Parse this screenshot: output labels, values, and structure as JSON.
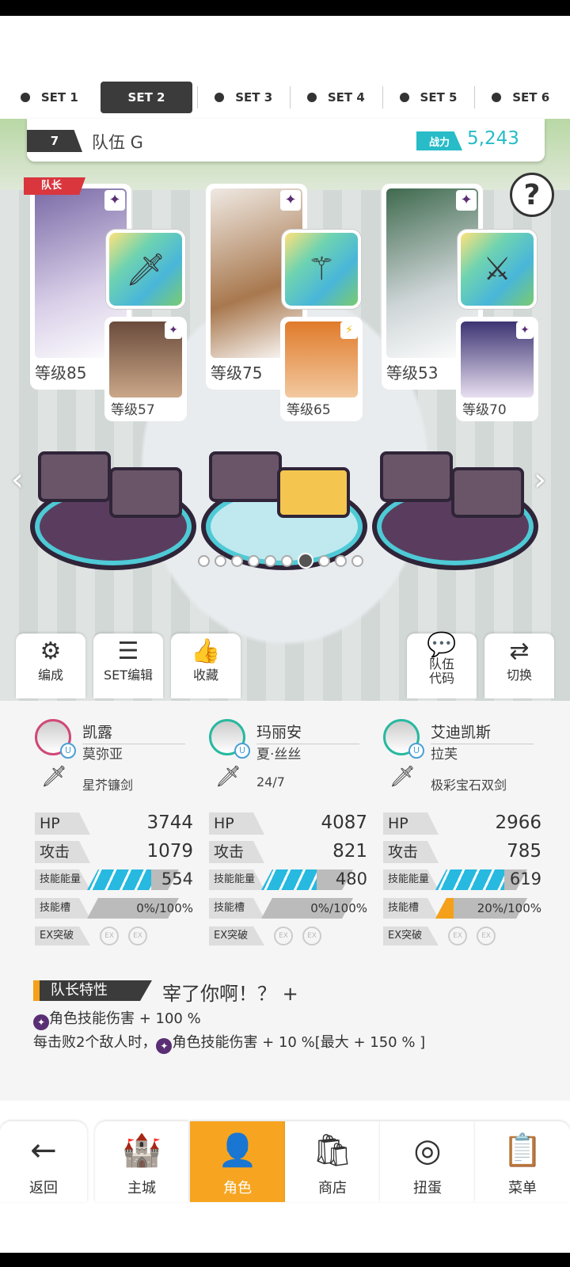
{
  "set_tabs": [
    {
      "label": "SET 1"
    },
    {
      "label": "SET 2"
    },
    {
      "label": "SET 3"
    },
    {
      "label": "SET 4"
    },
    {
      "label": "SET 5"
    },
    {
      "label": "SET 6"
    }
  ],
  "active_set": "SET 2",
  "team": {
    "number": "7",
    "name": "队伍 G",
    "power_label": "战力",
    "power_value": "5,243"
  },
  "leader_tag": "队长",
  "help_label": "?",
  "cards": [
    {
      "level": "等级85",
      "sub_level": "等级57",
      "weapon_icon": "sword-icon"
    },
    {
      "level": "等级75",
      "sub_level": "等级65",
      "weapon_icon": "staff-icon"
    },
    {
      "level": "等级53",
      "sub_level": "等级70",
      "weapon_icon": "dual-swords-icon"
    }
  ],
  "tools": [
    {
      "label": "编成",
      "icon": "formation-icon"
    },
    {
      "label": "SET编辑",
      "icon": "list-icon"
    },
    {
      "label": "收藏",
      "icon": "favorite-icon"
    },
    {
      "label": "队伍\n代码",
      "icon": "chat-icon"
    },
    {
      "label": "切换",
      "icon": "swap-icon"
    }
  ],
  "heroes": [
    {
      "name": "凯露",
      "sub": "莫弥亚",
      "weapon": "星芥镰剑",
      "hp": "3744",
      "atk": "1079",
      "energy": "554",
      "slot": "0%/100%",
      "energy_fill": 0.7,
      "slot_fill": 0.0
    },
    {
      "name": "玛丽安",
      "sub": "夏·丝丝",
      "weapon": "24/7",
      "hp": "4087",
      "atk": "821",
      "energy": "480",
      "slot": "0%/100%",
      "energy_fill": 0.6,
      "slot_fill": 0.0
    },
    {
      "name": "艾迪凯斯",
      "sub": "拉芙",
      "weapon": "极彩宝石双剑",
      "hp": "2966",
      "atk": "785",
      "energy": "619",
      "slot": "20%/100%",
      "energy_fill": 0.75,
      "slot_fill": 0.2
    }
  ],
  "stat_labels": {
    "hp": "HP",
    "atk": "攻击",
    "energy": "技能能量",
    "slot": "技能槽",
    "ex": "EX突破",
    "ex_badge": "EX"
  },
  "trait": {
    "label": "队长特性",
    "title": "宰了你啊！？ +",
    "line1": "角色技能伤害 + 100 %",
    "line2a": "每击败2个敌人时，",
    "line2b": "角色技能伤害 + 10 %[最大 + 150 % ]"
  },
  "nav": [
    {
      "label": "返回",
      "icon": "back-arrow-icon"
    },
    {
      "label": "主城",
      "icon": "town-icon"
    },
    {
      "label": "角色",
      "icon": "character-icon"
    },
    {
      "label": "商店",
      "icon": "shop-icon"
    },
    {
      "label": "扭蛋",
      "icon": "gacha-icon"
    },
    {
      "label": "菜单",
      "icon": "menu-icon"
    }
  ]
}
